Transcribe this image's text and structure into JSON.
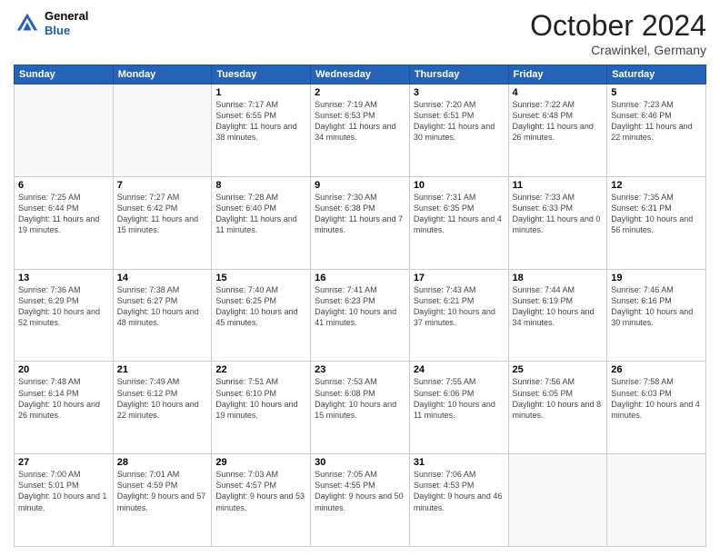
{
  "header": {
    "logo_line1": "General",
    "logo_line2": "Blue",
    "month_title": "October 2024",
    "location": "Crawinkel, Germany"
  },
  "days_of_week": [
    "Sunday",
    "Monday",
    "Tuesday",
    "Wednesday",
    "Thursday",
    "Friday",
    "Saturday"
  ],
  "weeks": [
    [
      {
        "num": "",
        "sunrise": "",
        "sunset": "",
        "daylight": ""
      },
      {
        "num": "",
        "sunrise": "",
        "sunset": "",
        "daylight": ""
      },
      {
        "num": "1",
        "sunrise": "Sunrise: 7:17 AM",
        "sunset": "Sunset: 6:55 PM",
        "daylight": "Daylight: 11 hours and 38 minutes."
      },
      {
        "num": "2",
        "sunrise": "Sunrise: 7:19 AM",
        "sunset": "Sunset: 6:53 PM",
        "daylight": "Daylight: 11 hours and 34 minutes."
      },
      {
        "num": "3",
        "sunrise": "Sunrise: 7:20 AM",
        "sunset": "Sunset: 6:51 PM",
        "daylight": "Daylight: 11 hours and 30 minutes."
      },
      {
        "num": "4",
        "sunrise": "Sunrise: 7:22 AM",
        "sunset": "Sunset: 6:48 PM",
        "daylight": "Daylight: 11 hours and 26 minutes."
      },
      {
        "num": "5",
        "sunrise": "Sunrise: 7:23 AM",
        "sunset": "Sunset: 6:46 PM",
        "daylight": "Daylight: 11 hours and 22 minutes."
      }
    ],
    [
      {
        "num": "6",
        "sunrise": "Sunrise: 7:25 AM",
        "sunset": "Sunset: 6:44 PM",
        "daylight": "Daylight: 11 hours and 19 minutes."
      },
      {
        "num": "7",
        "sunrise": "Sunrise: 7:27 AM",
        "sunset": "Sunset: 6:42 PM",
        "daylight": "Daylight: 11 hours and 15 minutes."
      },
      {
        "num": "8",
        "sunrise": "Sunrise: 7:28 AM",
        "sunset": "Sunset: 6:40 PM",
        "daylight": "Daylight: 11 hours and 11 minutes."
      },
      {
        "num": "9",
        "sunrise": "Sunrise: 7:30 AM",
        "sunset": "Sunset: 6:38 PM",
        "daylight": "Daylight: 11 hours and 7 minutes."
      },
      {
        "num": "10",
        "sunrise": "Sunrise: 7:31 AM",
        "sunset": "Sunset: 6:35 PM",
        "daylight": "Daylight: 11 hours and 4 minutes."
      },
      {
        "num": "11",
        "sunrise": "Sunrise: 7:33 AM",
        "sunset": "Sunset: 6:33 PM",
        "daylight": "Daylight: 11 hours and 0 minutes."
      },
      {
        "num": "12",
        "sunrise": "Sunrise: 7:35 AM",
        "sunset": "Sunset: 6:31 PM",
        "daylight": "Daylight: 10 hours and 56 minutes."
      }
    ],
    [
      {
        "num": "13",
        "sunrise": "Sunrise: 7:36 AM",
        "sunset": "Sunset: 6:29 PM",
        "daylight": "Daylight: 10 hours and 52 minutes."
      },
      {
        "num": "14",
        "sunrise": "Sunrise: 7:38 AM",
        "sunset": "Sunset: 6:27 PM",
        "daylight": "Daylight: 10 hours and 48 minutes."
      },
      {
        "num": "15",
        "sunrise": "Sunrise: 7:40 AM",
        "sunset": "Sunset: 6:25 PM",
        "daylight": "Daylight: 10 hours and 45 minutes."
      },
      {
        "num": "16",
        "sunrise": "Sunrise: 7:41 AM",
        "sunset": "Sunset: 6:23 PM",
        "daylight": "Daylight: 10 hours and 41 minutes."
      },
      {
        "num": "17",
        "sunrise": "Sunrise: 7:43 AM",
        "sunset": "Sunset: 6:21 PM",
        "daylight": "Daylight: 10 hours and 37 minutes."
      },
      {
        "num": "18",
        "sunrise": "Sunrise: 7:44 AM",
        "sunset": "Sunset: 6:19 PM",
        "daylight": "Daylight: 10 hours and 34 minutes."
      },
      {
        "num": "19",
        "sunrise": "Sunrise: 7:46 AM",
        "sunset": "Sunset: 6:16 PM",
        "daylight": "Daylight: 10 hours and 30 minutes."
      }
    ],
    [
      {
        "num": "20",
        "sunrise": "Sunrise: 7:48 AM",
        "sunset": "Sunset: 6:14 PM",
        "daylight": "Daylight: 10 hours and 26 minutes."
      },
      {
        "num": "21",
        "sunrise": "Sunrise: 7:49 AM",
        "sunset": "Sunset: 6:12 PM",
        "daylight": "Daylight: 10 hours and 22 minutes."
      },
      {
        "num": "22",
        "sunrise": "Sunrise: 7:51 AM",
        "sunset": "Sunset: 6:10 PM",
        "daylight": "Daylight: 10 hours and 19 minutes."
      },
      {
        "num": "23",
        "sunrise": "Sunrise: 7:53 AM",
        "sunset": "Sunset: 6:08 PM",
        "daylight": "Daylight: 10 hours and 15 minutes."
      },
      {
        "num": "24",
        "sunrise": "Sunrise: 7:55 AM",
        "sunset": "Sunset: 6:06 PM",
        "daylight": "Daylight: 10 hours and 11 minutes."
      },
      {
        "num": "25",
        "sunrise": "Sunrise: 7:56 AM",
        "sunset": "Sunset: 6:05 PM",
        "daylight": "Daylight: 10 hours and 8 minutes."
      },
      {
        "num": "26",
        "sunrise": "Sunrise: 7:58 AM",
        "sunset": "Sunset: 6:03 PM",
        "daylight": "Daylight: 10 hours and 4 minutes."
      }
    ],
    [
      {
        "num": "27",
        "sunrise": "Sunrise: 7:00 AM",
        "sunset": "Sunset: 5:01 PM",
        "daylight": "Daylight: 10 hours and 1 minute."
      },
      {
        "num": "28",
        "sunrise": "Sunrise: 7:01 AM",
        "sunset": "Sunset: 4:59 PM",
        "daylight": "Daylight: 9 hours and 57 minutes."
      },
      {
        "num": "29",
        "sunrise": "Sunrise: 7:03 AM",
        "sunset": "Sunset: 4:57 PM",
        "daylight": "Daylight: 9 hours and 53 minutes."
      },
      {
        "num": "30",
        "sunrise": "Sunrise: 7:05 AM",
        "sunset": "Sunset: 4:55 PM",
        "daylight": "Daylight: 9 hours and 50 minutes."
      },
      {
        "num": "31",
        "sunrise": "Sunrise: 7:06 AM",
        "sunset": "Sunset: 4:53 PM",
        "daylight": "Daylight: 9 hours and 46 minutes."
      },
      {
        "num": "",
        "sunrise": "",
        "sunset": "",
        "daylight": ""
      },
      {
        "num": "",
        "sunrise": "",
        "sunset": "",
        "daylight": ""
      }
    ]
  ]
}
